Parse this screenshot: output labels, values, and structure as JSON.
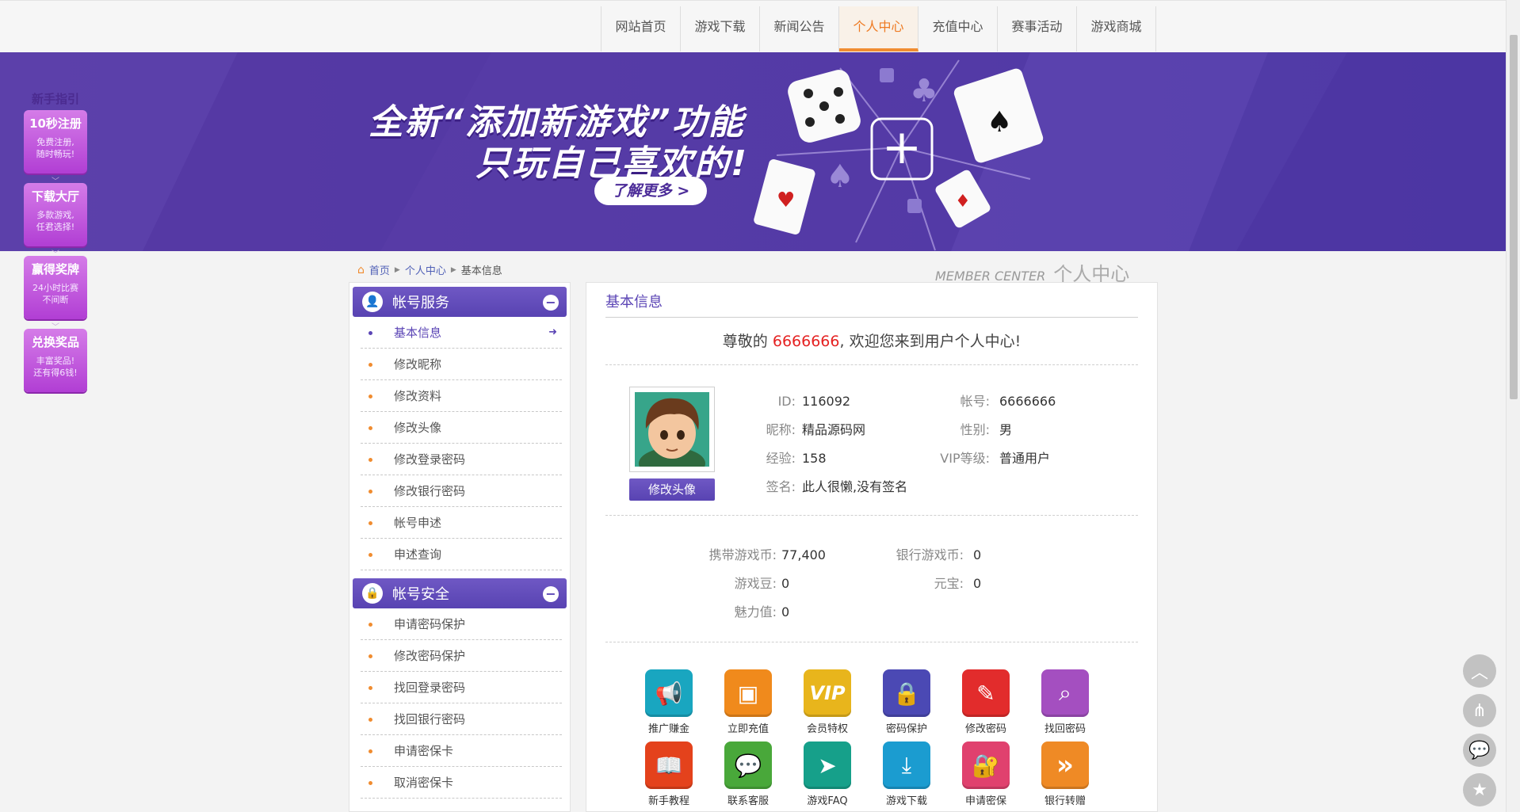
{
  "nav": {
    "items": [
      "网站首页",
      "游戏下载",
      "新闻公告",
      "个人中心",
      "充值中心",
      "赛事活动",
      "游戏商城"
    ],
    "active_index": 3
  },
  "banner": {
    "line1": "全新“添加新游戏”功能",
    "line2": "只玩自己喜欢的!",
    "learn_more": "了解更多 >"
  },
  "guide": {
    "title": "新手指引",
    "cards": [
      {
        "title": "10秒注册",
        "desc1": "免费注册,",
        "desc2": "随时畅玩!"
      },
      {
        "title": "下载大厅",
        "desc1": "多款游戏,",
        "desc2": "任君选择!"
      },
      {
        "title": "赢得奖牌",
        "desc1": "24小时比赛",
        "desc2": "不间断"
      },
      {
        "title": "兑换奖品",
        "desc1": "丰富奖品!",
        "desc2": "还有得6钱!"
      }
    ]
  },
  "breadcrumb": {
    "home": "首页",
    "level1": "个人中心",
    "current": "基本信息"
  },
  "member_center": {
    "en": "MEMBER CENTER",
    "cn": "个人中心"
  },
  "sidebar": {
    "account_service": {
      "title": "帐号服务",
      "items": [
        "基本信息",
        "修改昵称",
        "修改资料",
        "修改头像",
        "修改登录密码",
        "修改银行密码",
        "帐号申述",
        "申述查询"
      ]
    },
    "account_security": {
      "title": "帐号安全",
      "items": [
        "申请密码保护",
        "修改密码保护",
        "找回登录密码",
        "找回银行密码",
        "申请密保卡",
        "取消密保卡"
      ]
    }
  },
  "main": {
    "title": "基本信息",
    "welcome_prefix": "尊敬的",
    "username": "6666666",
    "welcome_suffix": ",  欢迎您来到用户个人中心!",
    "change_avatar": "修改头像",
    "profile": {
      "id_label": "ID:",
      "id": "116092",
      "account_label": "帐号:",
      "account": "6666666",
      "nickname_label": "昵称:",
      "nickname": "精品源码网",
      "gender_label": "性别:",
      "gender": "男",
      "exp_label": "经验:",
      "exp": "158",
      "vip_label": "VIP等级:",
      "vip": "普通用户",
      "sign_label": "签名:",
      "sign": "此人很懒,没有签名"
    },
    "coins": {
      "carry_label": "携带游戏币:",
      "carry": "77,400",
      "bank_label": "银行游戏币:",
      "bank": "0",
      "beans_label": "游戏豆:",
      "beans": "0",
      "yuanbao_label": "元宝:",
      "yuanbao": "0",
      "charm_label": "魅力值:",
      "charm": "0"
    },
    "shortcuts": [
      {
        "label": "推广赚金",
        "icon": "megaphone-icon",
        "color": "#19a6c0"
      },
      {
        "label": "立即充值",
        "icon": "wallet-icon",
        "color": "#f08a1c"
      },
      {
        "label": "会员特权",
        "icon": "vip-icon",
        "color": "#e8b51c"
      },
      {
        "label": "密码保护",
        "icon": "lock-icon",
        "color": "#4b49b4"
      },
      {
        "label": "修改密码",
        "icon": "pencil-icon",
        "color": "#e22c2c"
      },
      {
        "label": "找回密码",
        "icon": "magnifier-icon",
        "color": "#a44fc0"
      },
      {
        "label": "新手教程",
        "icon": "book-icon",
        "color": "#e4421c"
      },
      {
        "label": "联系客服",
        "icon": "chat-icon",
        "color": "#49a83a"
      },
      {
        "label": "游戏FAQ",
        "icon": "paper-plane-icon",
        "color": "#16a08a"
      },
      {
        "label": "游戏下载",
        "icon": "download-icon",
        "color": "#1b9cd0"
      },
      {
        "label": "申请密保",
        "icon": "padlock-icon",
        "color": "#e0416e"
      },
      {
        "label": "银行转赠",
        "icon": "double-chevron-icon",
        "color": "#ef8a25"
      }
    ]
  }
}
